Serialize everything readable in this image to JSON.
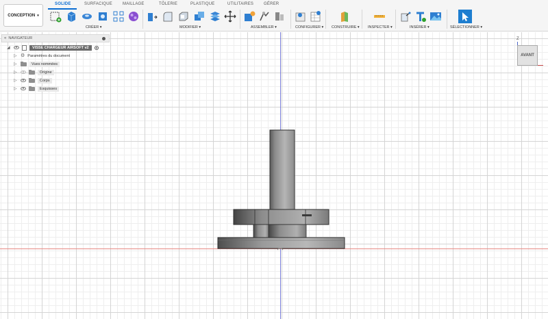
{
  "workspace": {
    "label": "CONCEPTION"
  },
  "tabs": [
    {
      "label": "SOLIDE",
      "active": true
    },
    {
      "label": "SURFACIQUE"
    },
    {
      "label": "MAILLAGE"
    },
    {
      "label": "TÔLERIE"
    },
    {
      "label": "PLASTIQUE"
    },
    {
      "label": "UTILITAIRES"
    },
    {
      "label": "GÉRER"
    }
  ],
  "groups": {
    "creer": "CRÉER ▾",
    "modifier": "MODIFIER ▾",
    "assembler": "ASSEMBLER ▾",
    "configurer": "CONFIGURER ▾",
    "construire": "CONSTRUIRE ▾",
    "inspecter": "INSPECTER ▾",
    "inserer": "INSÉRER ▾",
    "selectionner": "SÉLECTIONNER ▾"
  },
  "navigator": {
    "title": "NAVIGATEUR",
    "document": "VISSE CHARGEUR AIRSOFT v2",
    "items": [
      {
        "label": "Paramètres du document",
        "icon": "gear-icon"
      },
      {
        "label": "Vues nommées",
        "icon": "folder-icon"
      },
      {
        "label": "Origine",
        "icon": "folder-icon",
        "hidden": true
      },
      {
        "label": "Corps",
        "icon": "folder-icon"
      },
      {
        "label": "Esquisses",
        "icon": "folder-icon"
      }
    ]
  },
  "viewcube": {
    "face": "AVANT",
    "axis": "Z"
  },
  "colors": {
    "accent": "#0a6cd2",
    "axis_vertical": "#7b7fd8",
    "axis_horizontal": "#e68a84",
    "model_dark": "#4a4a4a",
    "model_light": "#a9a9a9"
  }
}
